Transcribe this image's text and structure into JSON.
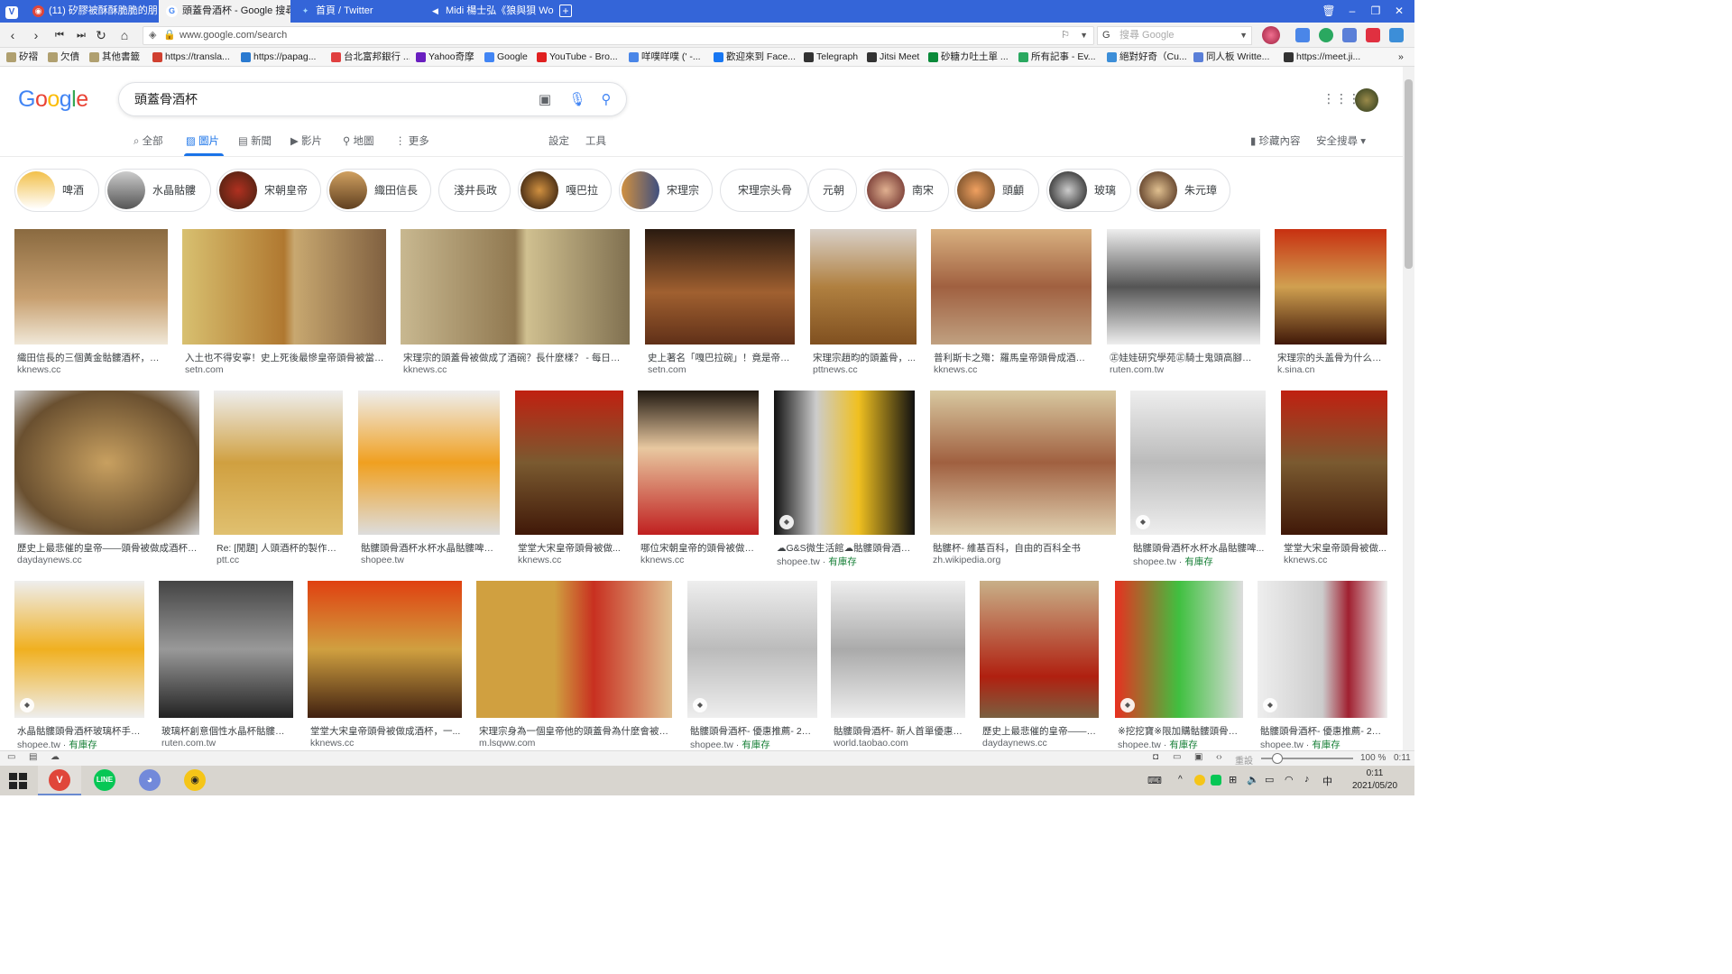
{
  "browser": {
    "tabs": [
      {
        "label": "(11) 矽膠被酥酥脆脆的朋友",
        "icon": "vivaldi-icon"
      },
      {
        "label": "頭蓋骨酒杯 - Google 搜尋",
        "icon": "google-icon",
        "active": true
      },
      {
        "label": "首頁 / Twitter",
        "icon": "twitter-icon"
      },
      {
        "label": "Midi 楊士弘《狼與狽 Wolf",
        "icon": "speaker-icon"
      }
    ],
    "url": "www.google.com/search",
    "web_search_placeholder": "搜尋 Google",
    "bookmarks": [
      "矽褶",
      "欠債",
      "其他書籤",
      "https://transla...",
      "https://papag...",
      "台北富邦銀行 ...",
      "Yahoo奇摩",
      "Google",
      "YouTube - Bro...",
      "咩噗咩噗 (' -...",
      "歡迎來到 Face...",
      "Telegraph",
      "Jitsi Meet",
      "砂糖カ吐土單 ...",
      "所有記事 - Ev...",
      "絕對好奇（Cu...",
      "同人板 Writte...",
      "https://meet.ji..."
    ]
  },
  "google": {
    "logo": "Google",
    "query": "頭蓋骨酒杯",
    "nav_tabs": [
      "全部",
      "圖片",
      "新聞",
      "影片",
      "地圖",
      "更多"
    ],
    "active_tab": "圖片",
    "settings": "設定",
    "tools": "工具",
    "collections": "珍藏內容",
    "safe_search": "安全搜尋",
    "chips": [
      "啤酒",
      "水晶骷髏",
      "宋朝皇帝",
      "織田信長",
      "淺井長政",
      "嘎巴拉",
      "宋理宗",
      "宋理宗头骨",
      "元朝",
      "南宋",
      "頭顱",
      "玻璃",
      "朱元璋"
    ],
    "results": [
      [
        {
          "caption": "織田信長的三個黃金骷髏酒杯，到...",
          "source": "kknews.cc"
        },
        {
          "caption": "入土也不得安寧！史上死後最慘皇帝頭骨被當酒...",
          "source": "setn.com"
        },
        {
          "caption": "宋理宗的頭蓋骨被做成了酒碗？長什麼樣？ - 每日頭條",
          "source": "kknews.cc"
        },
        {
          "caption": "史上著名「嘎巴拉碗」！竟是帝王...",
          "source": "setn.com"
        },
        {
          "caption": "宋理宗趙昀的頭蓋骨，...",
          "source": "pttnews.cc"
        },
        {
          "caption": "普利斯卡之殤：羅馬皇帝頭骨成酒杯-...",
          "source": "kknews.cc"
        },
        {
          "caption": "㊣娃娃研究學苑㊣騎士鬼頭高腳杯...",
          "source": "ruten.com.tw"
        },
        {
          "caption": "宋理宗的头盖骨为什么被...",
          "source": "k.sina.cn"
        }
      ],
      [
        {
          "caption": "歷史上最悲催的皇帝——頭骨被做成酒杯近...",
          "source": "daydaynews.cc"
        },
        {
          "caption": "Re: [閒題] 人頭酒杯的製作方...",
          "source": "ptt.cc"
        },
        {
          "caption": "骷髏頭骨酒杯水杯水晶骷髏啤酒...",
          "source": "shopee.tw"
        },
        {
          "caption": "堂堂大宋皇帝頭骨被做...",
          "source": "kknews.cc"
        },
        {
          "caption": "哪位宋朝皇帝的頭骨被做成...",
          "source": "kknews.cc"
        },
        {
          "caption": "☁G&S微生活館☁骷髏頭骨酒杯...",
          "source": "shopee.tw",
          "stock": "有庫存"
        },
        {
          "caption": "骷髏杯- 維基百科，自由的百科全书",
          "source": "zh.wikipedia.org"
        },
        {
          "caption": "骷髏頭骨酒杯水杯水晶骷髏啤...",
          "source": "shopee.tw",
          "stock": "有庫存"
        },
        {
          "caption": "堂堂大宋皇帝頭骨被做...",
          "source": "kknews.cc"
        }
      ],
      [
        {
          "caption": "水晶骷髏頭骨酒杯玻璃杯手柄...",
          "source": "shopee.tw",
          "stock": "有庫存"
        },
        {
          "caption": "玻璃杯創意個性水晶杯骷髏頭...",
          "source": "ruten.com.tw"
        },
        {
          "caption": "堂堂大宋皇帝頭骨被做成酒杯，一...",
          "source": "kknews.cc"
        },
        {
          "caption": "宋理宗身為一個皇帝他的頭蓋骨為什麼會被製...",
          "source": "m.lsqww.com"
        },
        {
          "caption": "骷髏頭骨酒杯- 優惠推薦- 202...",
          "source": "shopee.tw",
          "stock": "有庫存"
        },
        {
          "caption": "骷髏頭骨酒杯- 新人首單優惠推...",
          "source": "world.taobao.com"
        },
        {
          "caption": "歷史上最悲催的皇帝——頭...",
          "source": "daydaynews.cc"
        },
        {
          "caption": "※挖挖寶※限加購骷髏頭骨酒...",
          "source": "shopee.tw",
          "stock": "有庫存"
        },
        {
          "caption": "骷髏頭骨酒杯- 優惠推薦- 202...",
          "source": "shopee.tw",
          "stock": "有庫存"
        }
      ]
    ]
  },
  "statusbar": {
    "reset": "重設",
    "zoom": "100 %",
    "time": "0:11"
  },
  "taskbar": {
    "time": "0:11",
    "date": "2021/05/20"
  },
  "colors": {
    "accent": "#1a73e8",
    "tabbar": "#3465d8",
    "stock_green": "#188038"
  }
}
